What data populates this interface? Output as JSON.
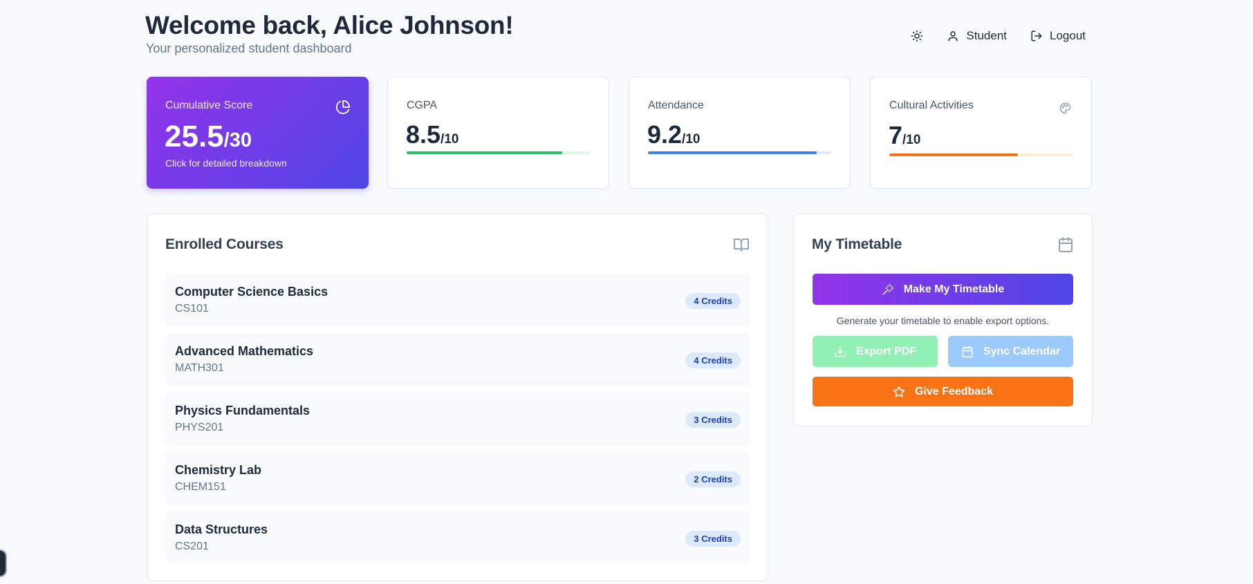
{
  "header": {
    "title": "Welcome back, Alice Johnson!",
    "subtitle": "Your personalized student dashboard",
    "role_label": "Student",
    "logout_label": "Logout"
  },
  "stats": {
    "score": {
      "label": "Cumulative Score",
      "value": "25.5",
      "max": "/30",
      "hint": "Click for detailed breakdown"
    },
    "cgpa": {
      "label": "CGPA",
      "value": "8.5",
      "max": "/10",
      "progress": 0.85,
      "color": "#22c55e",
      "track": "#dcfce7"
    },
    "attendance": {
      "label": "Attendance",
      "value": "9.2",
      "max": "/10",
      "progress": 0.92,
      "color": "#3b82f6",
      "track": "#dbeafe"
    },
    "cultural": {
      "label": "Cultural Activities",
      "value": "7",
      "max": "/10",
      "progress": 0.7,
      "color": "#f97316",
      "track": "#ffedd5"
    }
  },
  "courses": {
    "title": "Enrolled Courses",
    "items": [
      {
        "name": "Computer Science Basics",
        "code": "CS101",
        "credits": "4 Credits"
      },
      {
        "name": "Advanced Mathematics",
        "code": "MATH301",
        "credits": "4 Credits"
      },
      {
        "name": "Physics Fundamentals",
        "code": "PHYS201",
        "credits": "3 Credits"
      },
      {
        "name": "Chemistry Lab",
        "code": "CHEM151",
        "credits": "2 Credits"
      },
      {
        "name": "Data Structures",
        "code": "CS201",
        "credits": "3 Credits"
      }
    ]
  },
  "timetable": {
    "title": "My Timetable",
    "make_label": "Make My Timetable",
    "note": "Generate your timetable to enable export options.",
    "export_label": "Export PDF",
    "sync_label": "Sync Calendar",
    "feedback_label": "Give Feedback"
  },
  "icons": {
    "theme": "sun-icon",
    "user": "user-icon",
    "logout": "logout-icon",
    "score": "pie-chart-icon",
    "cultural": "palette-icon",
    "courses": "book-open-icon",
    "timetable": "calendar-icon"
  }
}
